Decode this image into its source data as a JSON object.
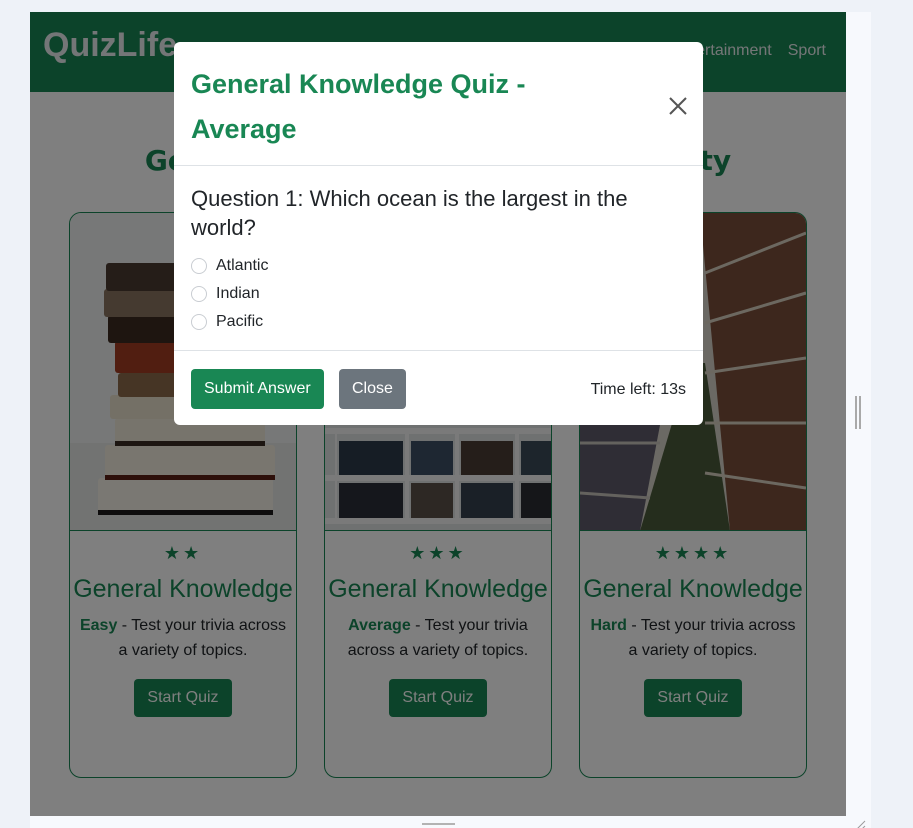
{
  "navbar": {
    "brand": "QuizLife",
    "links": [
      "Entertainment",
      "Sport"
    ]
  },
  "page": {
    "heading": "General Knowledge Quiz by Difficulty"
  },
  "cards": [
    {
      "stars": "★★",
      "title": "General Knowledge",
      "level": "Easy",
      "description": " - Test your trivia across a variety of topics.",
      "button": "Start Quiz"
    },
    {
      "stars": "★★★",
      "title": "General Knowledge",
      "level": "Average",
      "description": " - Test your trivia across a variety of topics.",
      "button": "Start Quiz"
    },
    {
      "stars": "★★★★",
      "title": "General Knowledge",
      "level": "Hard",
      "description": " - Test your trivia across a variety of topics.",
      "button": "Start Quiz"
    }
  ],
  "modal": {
    "title": "General Knowledge Quiz - Average",
    "question": "Question 1: Which ocean is the largest in the world?",
    "options": [
      "Atlantic",
      "Indian",
      "Pacific"
    ],
    "submit_label": "Submit Answer",
    "close_label": "Close",
    "timer": "Time left: 13s"
  },
  "colors": {
    "accent": "#198754",
    "secondary": "#6c757d",
    "backdrop": "rgba(0,0,0,0.5)"
  },
  "icons": {
    "modal_close": "close-icon",
    "card_images": [
      "book-stack-image",
      "bookshelf-image",
      "library-aisle-image"
    ]
  }
}
